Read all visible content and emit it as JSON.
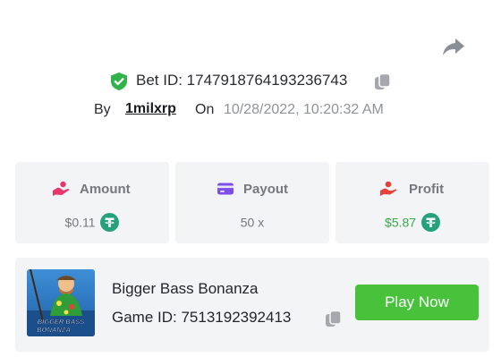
{
  "bet": {
    "id_label": "Bet ID: 1747918764193236743",
    "by_label": "By",
    "username": "1milxrp",
    "on_label": "On",
    "timestamp": "10/28/2022, 10:20:32 AM"
  },
  "stats": {
    "amount": {
      "title": "Amount",
      "value": "$0.11",
      "icon": "coins-hand-icon",
      "currency_icon": "tether-icon"
    },
    "payout": {
      "title": "Payout",
      "value": "50 x",
      "icon": "card-icon"
    },
    "profit": {
      "title": "Profit",
      "value": "$5.87",
      "icon": "hand-money-icon",
      "currency_icon": "tether-icon"
    }
  },
  "game": {
    "name": "Bigger Bass Bonanza",
    "game_id_label": "Game ID: 7513192392413",
    "play_label": "Play Now",
    "thumbnail_text_line1": "BIGGER BASS",
    "thumbnail_text_line2": "BONANZA"
  },
  "colors": {
    "accent_green": "#48c23a",
    "profit_green": "#39a84a",
    "pink_icon": "#e8356b",
    "purple_icon": "#7b4fe8",
    "red_icon": "#e8403a",
    "tether": "#26a17b",
    "card_bg": "#f3f4f6"
  }
}
